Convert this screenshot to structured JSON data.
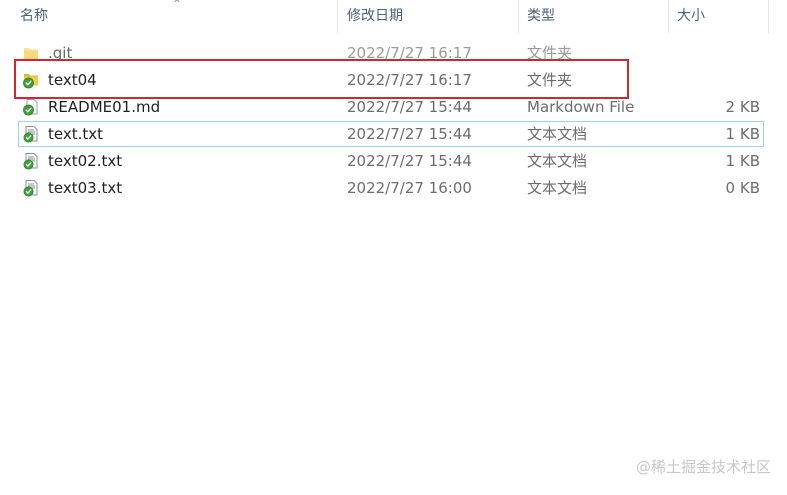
{
  "columns": {
    "name": "名称",
    "date": "修改日期",
    "type": "类型",
    "size": "大小"
  },
  "files": [
    {
      "name": ".git",
      "date": "2022/7/27 16:17",
      "type": "文件夹",
      "size": "",
      "icon": "folder-icon"
    },
    {
      "name": "text04",
      "date": "2022/7/27 16:17",
      "type": "文件夹",
      "size": "",
      "icon": "folder-synced-icon"
    },
    {
      "name": "README01.md",
      "date": "2022/7/27 15:44",
      "type": "Markdown File",
      "size": "2 KB",
      "icon": "file-synced-icon"
    },
    {
      "name": "text.txt",
      "date": "2022/7/27 15:44",
      "type": "文本文档",
      "size": "1 KB",
      "icon": "text-file-synced-icon"
    },
    {
      "name": "text02.txt",
      "date": "2022/7/27 15:44",
      "type": "文本文档",
      "size": "1 KB",
      "icon": "text-file-synced-icon"
    },
    {
      "name": "text03.txt",
      "date": "2022/7/27 16:00",
      "type": "文本文档",
      "size": "0 KB",
      "icon": "text-file-synced-icon"
    }
  ],
  "watermark": "@稀土掘金技术社区",
  "colors": {
    "highlight": "#d9232d",
    "focus": "#99d1ff",
    "sync_badge": "#3aa336",
    "folder": "#f5c94a"
  }
}
